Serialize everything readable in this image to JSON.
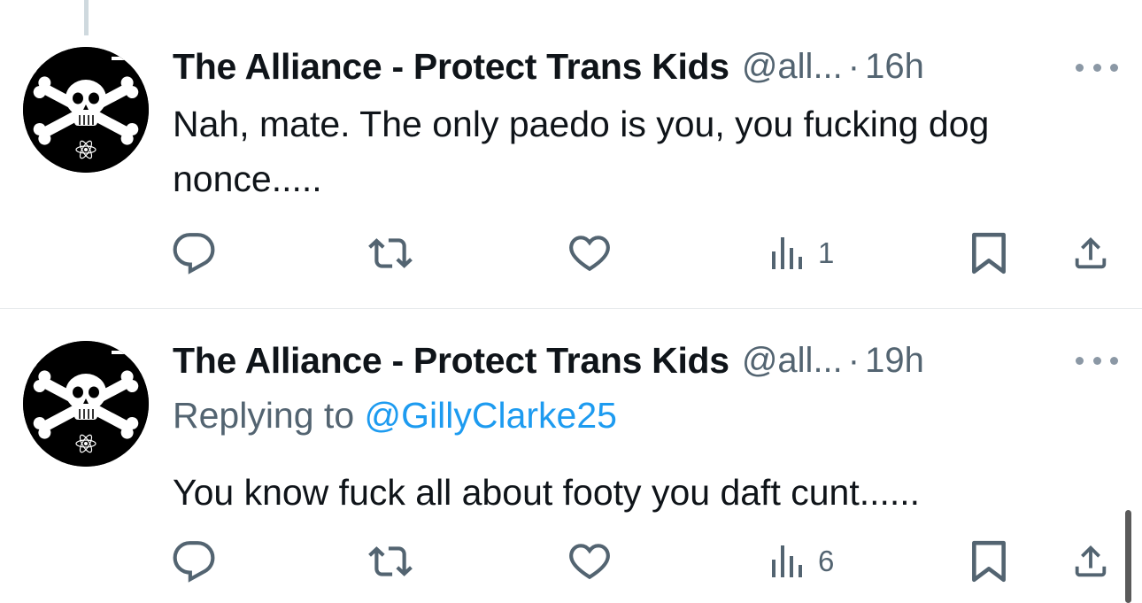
{
  "tweets": [
    {
      "author_name": "The Alliance - Protect Trans Kids",
      "handle": "@all...",
      "separator": "·",
      "time": "16h",
      "replying_to_prefix": "",
      "replying_to_mention": "",
      "text": "Nah, mate.  The only paedo is you, you fucking dog nonce.....",
      "views": "1"
    },
    {
      "author_name": "The Alliance - Protect Trans Kids",
      "handle": "@all...",
      "separator": "·",
      "time": "19h",
      "replying_to_prefix": "Replying to ",
      "replying_to_mention": "@GillyClarke25",
      "text": "You know fuck all about footy you daft cunt......",
      "views": "6"
    }
  ],
  "icons": {
    "reply": "reply-icon",
    "retweet": "retweet-icon",
    "like": "heart-icon",
    "views": "views-icon",
    "bookmark": "bookmark-icon",
    "share": "share-icon",
    "more": "more-icon",
    "avatar": "skull-crossbones-avatar"
  },
  "colors": {
    "text": "#0f1419",
    "secondary": "#536471",
    "link": "#1d9bf0",
    "divider": "#e6e9eb",
    "avatar_bg": "#000000"
  }
}
